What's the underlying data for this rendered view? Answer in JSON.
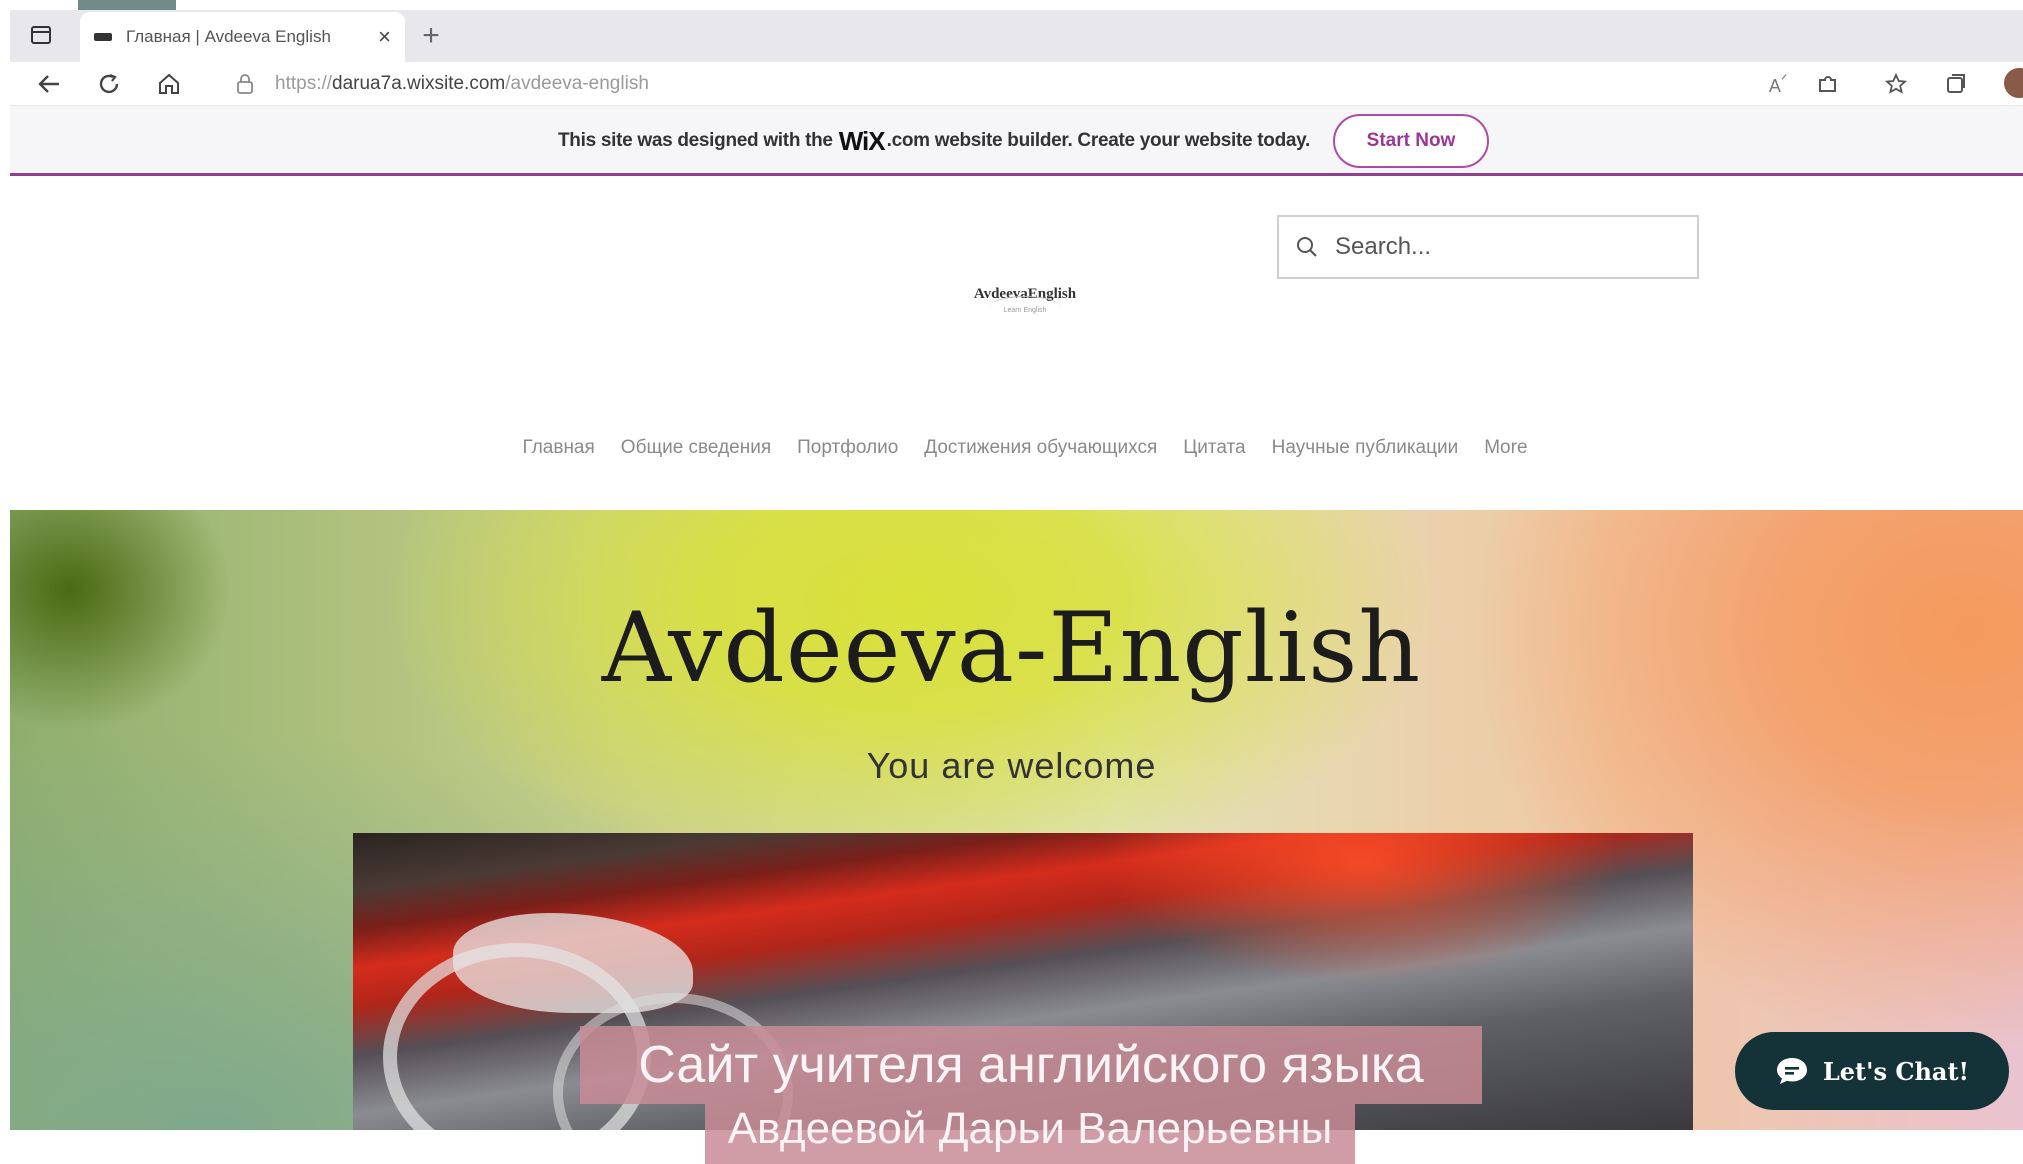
{
  "browser": {
    "tab_title": "Главная | Avdeeva English",
    "url_prefix": "https://",
    "url_host": "darua7a.wixsite.com",
    "url_path": "/avdeeva-english"
  },
  "banner": {
    "text_before": "This site was designed with the",
    "brand": "WiX",
    "text_after": ".com website builder. Create your website today.",
    "button": "Start Now"
  },
  "header": {
    "search_placeholder": "Search...",
    "logo_line1": "AvdeevaEnglish",
    "logo_line2": "Learn English",
    "nav": [
      "Главная",
      "Общие сведения",
      "Портфолио",
      "Достижения обучающихся",
      "Цитата",
      "Научные публикации",
      "More"
    ]
  },
  "hero": {
    "title": "Avdeeva-English",
    "subtitle": "You are welcome",
    "caption_line1": "Сайт учителя английского языка",
    "caption_line2": "Авдеевой Дарьи Валерьевны"
  },
  "chat": {
    "label": "Let's Chat!"
  },
  "colors": {
    "accent": "#8e3f8d",
    "chat_bg": "#143338"
  }
}
